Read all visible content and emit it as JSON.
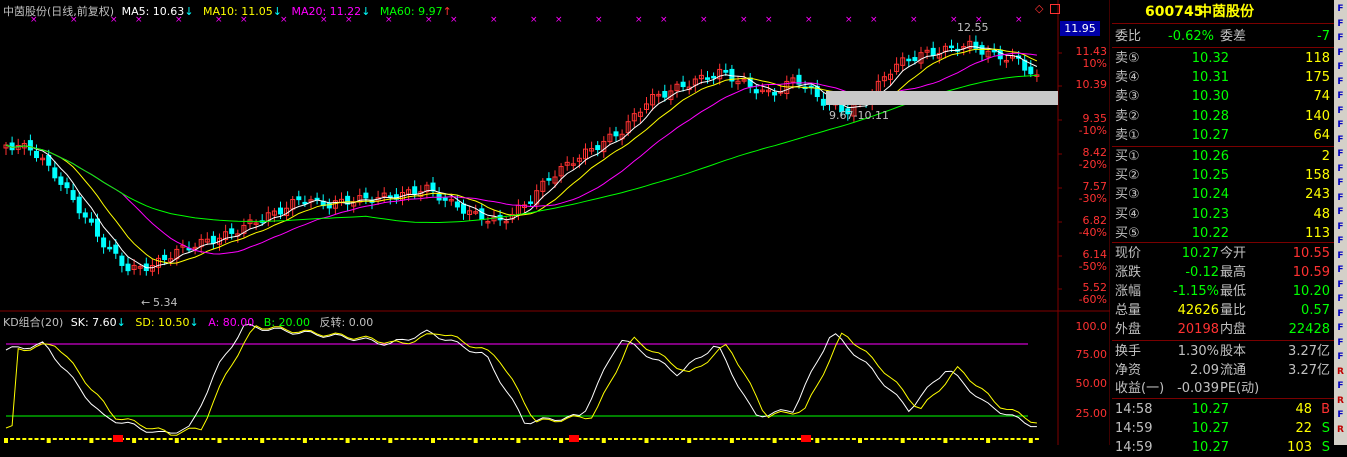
{
  "chart": {
    "title": "中茵股份(日线,前复权)",
    "ma5": "MA5: 10.63",
    "ma10": "MA10: 11.05",
    "ma20": "MA20: 11.22",
    "ma60": "MA60: 9.97",
    "price_tag": "11.95",
    "high_note": "12.55",
    "low_note": "5.34",
    "range_note": "9.67-10.11",
    "yaxis_prices": [
      "11.43",
      "10.39",
      "9.35",
      "8.42",
      "7.57",
      "6.82",
      "6.14",
      "5.52"
    ],
    "yaxis_pcts": [
      "10%",
      "-10%",
      "-20%",
      "-30%",
      "-40%",
      "-50%",
      "-60%"
    ],
    "colors": {
      "ma5": "#ffffff",
      "ma10": "#ffff00",
      "ma20": "#ff00ff",
      "ma60": "#00ff00",
      "up": "#ff3232",
      "down": "#00ffff",
      "grid": "#800000"
    }
  },
  "kd": {
    "title": "KD组合(20)",
    "sk": "SK: 7.60",
    "sd": "SD: 10.50",
    "a": "A: 80.00",
    "b": "B: 20.00",
    "reverse": "反转: 0.00",
    "yaxis": [
      "100.0",
      "75.00",
      "50.00",
      "25.00"
    ]
  },
  "quote": {
    "code": "600745",
    "name": "中茵股份",
    "ratio_label": "委比",
    "ratio_value": "-0.62%",
    "diff_label": "委差",
    "diff_value": "-7",
    "asks": [
      {
        "label": "卖⑤",
        "price": "10.32",
        "vol": "118"
      },
      {
        "label": "卖④",
        "price": "10.31",
        "vol": "175"
      },
      {
        "label": "卖③",
        "price": "10.30",
        "vol": "74"
      },
      {
        "label": "卖②",
        "price": "10.28",
        "vol": "140"
      },
      {
        "label": "卖①",
        "price": "10.27",
        "vol": "64"
      }
    ],
    "bids": [
      {
        "label": "买①",
        "price": "10.26",
        "vol": "2"
      },
      {
        "label": "买②",
        "price": "10.25",
        "vol": "158"
      },
      {
        "label": "买③",
        "price": "10.24",
        "vol": "243"
      },
      {
        "label": "买④",
        "price": "10.23",
        "vol": "48"
      },
      {
        "label": "买⑤",
        "price": "10.22",
        "vol": "113"
      }
    ],
    "stats": [
      {
        "l1": "现价",
        "v1": "10.27",
        "l2": "今开",
        "v2": "10.55"
      },
      {
        "l1": "涨跌",
        "v1": "-0.12",
        "l2": "最高",
        "v2": "10.59"
      },
      {
        "l1": "涨幅",
        "v1": "-1.15%",
        "l2": "最低",
        "v2": "10.20"
      },
      {
        "l1": "总量",
        "v1": "42626",
        "l2": "量比",
        "v2": "0.57"
      },
      {
        "l1": "外盘",
        "v1": "20198",
        "l2": "内盘",
        "v2": "22428"
      }
    ],
    "stats2": [
      {
        "l1": "换手",
        "v1": "1.30%",
        "l2": "股本",
        "v2": "3.27亿"
      },
      {
        "l1": "净资",
        "v1": "2.09",
        "l2": "流通",
        "v2": "3.27亿"
      },
      {
        "l1": "收益(一)",
        "v1": "-0.039",
        "l2": "PE(动)",
        "v2": ""
      }
    ],
    "ticks": [
      {
        "time": "14:58",
        "price": "10.27",
        "vol": "48",
        "dir": "B"
      },
      {
        "time": "14:59",
        "price": "10.27",
        "vol": "22",
        "dir": "S"
      },
      {
        "time": "14:59",
        "price": "10.27",
        "vol": "103",
        "dir": "S"
      }
    ]
  },
  "side_icons": [
    "F",
    "F",
    "F",
    "F",
    "F",
    "F",
    "F",
    "F",
    "F",
    "F",
    "F",
    "F",
    "F",
    "F",
    "F",
    "F",
    "F",
    "F",
    "F",
    "F",
    "F",
    "F",
    "F",
    "F",
    "F",
    "R",
    "F",
    "R",
    "F",
    "R"
  ]
}
